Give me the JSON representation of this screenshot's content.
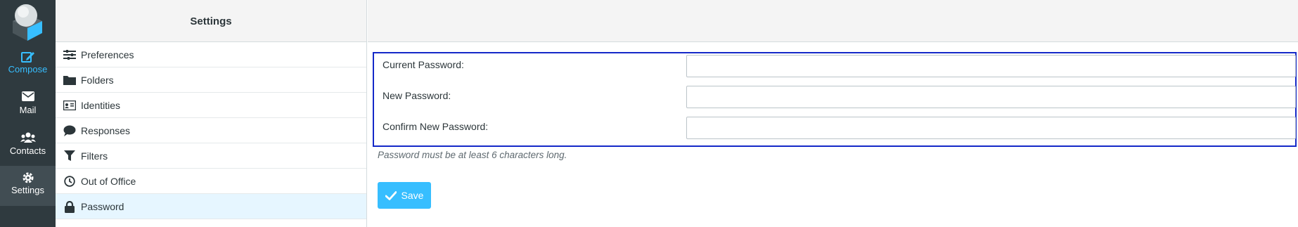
{
  "nav": {
    "items": [
      {
        "label": "Compose",
        "icon": "compose-icon"
      },
      {
        "label": "Mail",
        "icon": "envelope-icon"
      },
      {
        "label": "Contacts",
        "icon": "users-icon"
      },
      {
        "label": "Settings",
        "icon": "gear-icon"
      }
    ],
    "active": "Settings",
    "accent_color": "#37beff"
  },
  "settings_list": {
    "title": "Settings",
    "items": [
      {
        "label": "Preferences",
        "icon": "sliders-icon"
      },
      {
        "label": "Folders",
        "icon": "folder-icon"
      },
      {
        "label": "Identities",
        "icon": "id-card-icon"
      },
      {
        "label": "Responses",
        "icon": "comment-icon"
      },
      {
        "label": "Filters",
        "icon": "filter-icon"
      },
      {
        "label": "Out of Office",
        "icon": "clock-icon"
      },
      {
        "label": "Password",
        "icon": "lock-icon"
      }
    ],
    "selected": "Password"
  },
  "password_form": {
    "current_label": "Current Password:",
    "current_value": "",
    "new_label": "New Password:",
    "new_value": "",
    "confirm_label": "Confirm New Password:",
    "confirm_value": "",
    "hint": "Password must be at least 6 characters long.",
    "save_label": "Save",
    "highlight_color": "#1428c8"
  }
}
